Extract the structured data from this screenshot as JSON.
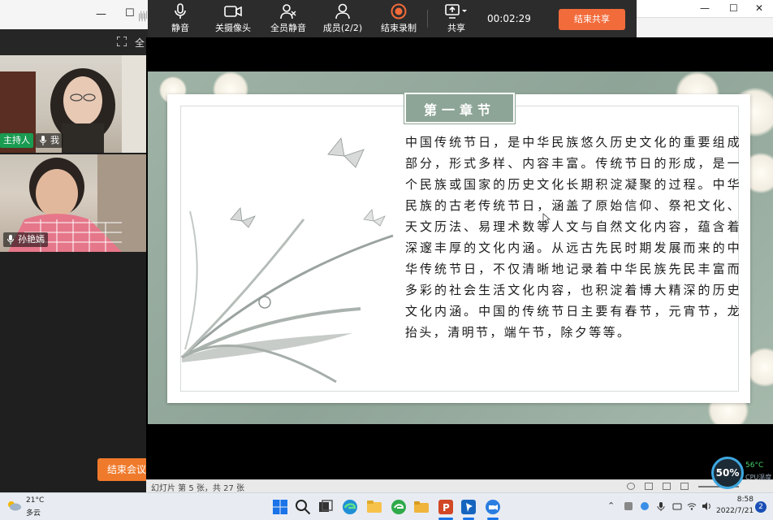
{
  "meeting": {
    "fullscreen_label": "全",
    "participants": [
      {
        "badge": "主持人",
        "name": "我"
      },
      {
        "name": "孙艳嫣"
      }
    ],
    "end_meeting_label": "结束会议"
  },
  "toolbar": {
    "mute_label": "静音",
    "camera_label": "关摄像头",
    "mute_all_label": "全员静音",
    "members_label": "成员(2/2)",
    "stop_record_label": "结束录制",
    "share_label": "共享",
    "timer": "00:02:29",
    "end_share_label": "结束共享"
  },
  "slide": {
    "chapter_title": "第一章节",
    "body": "中国传统节日，是中华民族悠久历史文化的重要组成部分，形式多样、内容丰富。传统节日的形成，是一个民族或国家的历史文化长期积淀凝聚的过程。中华民族的古老传统节日，涵盖了原始信仰、祭祀文化、天文历法、易理术数等人文与自然文化内容，蕴含着深邃丰厚的文化内涵。从远古先民时期发展而来的中华传统节日，不仅清晰地记录着中华民族先民丰富而多彩的社会生活文化内容，也积淀着博大精深的历史文化内涵。中国的传统节日主要有春节，元宵节，龙抬头，清明节，端午节，除夕等等。",
    "counter": "幻灯片 第 5 张，共 27 张"
  },
  "perf": {
    "percent": "50%",
    "temp": "56°C",
    "cpu_label": "CPU温度"
  },
  "taskbar": {
    "weather_temp": "21°C",
    "weather_desc": "多云",
    "time": "8:58",
    "date": "2022/7/21",
    "notification_count": "2"
  },
  "colors": {
    "accent_orange": "#f26b3a",
    "slide_green": "#8da596",
    "host_badge": "#1a9b52"
  }
}
